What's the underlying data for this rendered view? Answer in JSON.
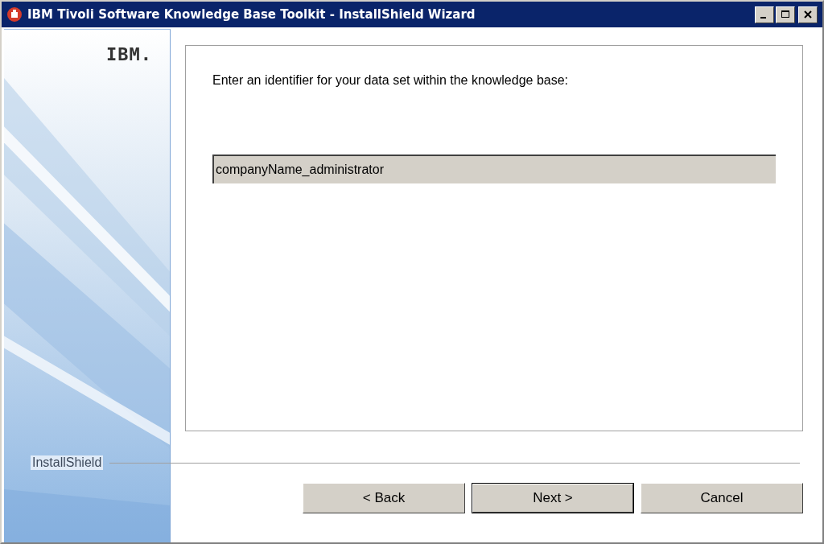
{
  "window": {
    "title": "IBM Tivoli Software Knowledge Base Toolkit - InstallShield Wizard"
  },
  "sidebar": {
    "logo": "IBM.",
    "brand": "InstallShield"
  },
  "content": {
    "prompt": "Enter an identifier for your data set within the knowledge base:",
    "field": {
      "value": "companyName_administrator",
      "disabled": true
    }
  },
  "buttons": [
    {
      "label": "< Back",
      "default": false
    },
    {
      "label": "Next >",
      "default": true
    },
    {
      "label": "Cancel",
      "default": false
    }
  ]
}
